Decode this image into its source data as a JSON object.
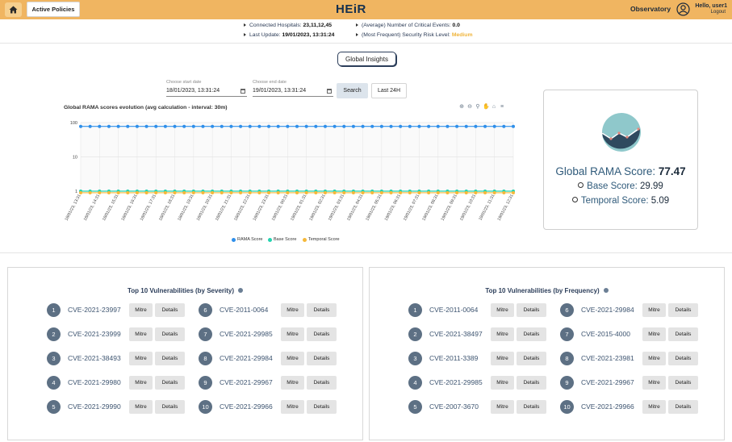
{
  "header": {
    "active_policies": "Active Policies",
    "logo": "HEiR",
    "observatory": "Observatory",
    "hello": "Hello, user1",
    "logout": "Logout",
    "bar_color": "#f0b561",
    "icons": [
      "home-icon",
      "user-icon"
    ]
  },
  "info": {
    "connected_label": "Connected Hospitals:",
    "connected_value": "23,11,12,45",
    "update_label": "Last Update:",
    "update_value": "19/01/2023, 13:31:24",
    "critical_label": "(Average) Number of Critical Events:",
    "critical_value": "0.0",
    "risk_label": "(Most Frequent) Security Risk Level:",
    "risk_value": "Medium",
    "risk_color": "#f0b43a"
  },
  "global_insights": "Global Insights",
  "date_filter": {
    "start_label": "Choose start date",
    "start_value": "18/01/2023, 13:31:24",
    "end_label": "Choose end date",
    "end_value": "19/01/2023, 13:31:24",
    "search": "Search",
    "last24": "Last 24H"
  },
  "chart_data": {
    "type": "line",
    "title": "Global RAMA scores evolution (avg calculation - interval: 30m)",
    "yscale": "log",
    "ylim": [
      1,
      100
    ],
    "y_ticks": [
      "100",
      "10",
      "1"
    ],
    "x": [
      "18/01/23, 13:31",
      "18/01/23, 14:31",
      "18/01/23, 15:31",
      "18/01/23, 16:31",
      "18/01/23, 17:31",
      "18/01/23, 18:31",
      "18/01/23, 19:31",
      "18/01/23, 20:31",
      "18/01/23, 21:31",
      "18/01/23, 22:31",
      "18/01/23, 23:31",
      "19/01/23, 00:31",
      "19/01/23, 01:31",
      "19/01/23, 02:31",
      "19/01/23, 03:31",
      "19/01/23, 04:31",
      "19/01/23, 05:31",
      "19/01/23, 06:31",
      "19/01/23, 07:31",
      "19/01/23, 08:31",
      "19/01/23, 09:31",
      "19/01/23, 10:31",
      "19/01/23, 11:31",
      "19/01/23, 12:31"
    ],
    "points_per_label": 2,
    "series": [
      {
        "name": "RAMA Score",
        "color": "#2f8fea",
        "value": 77.47
      },
      {
        "name": "Base Score",
        "color": "#24d3b0",
        "value": 1.0
      },
      {
        "name": "Temporal Score",
        "color": "#f5b83a",
        "value": 0.9
      }
    ],
    "legend_position": "bottom",
    "grid": true
  },
  "rama": {
    "global_label": "Global RAMA Score:",
    "global_value": "77.47",
    "base_label": "Base Score:",
    "base_value": "29.99",
    "temporal_label": "Temporal Score:",
    "temporal_value": "5.09",
    "icon_color_top": "#8fc8cb",
    "icon_color_bottom": "#2f4a5f"
  },
  "severity": {
    "title": "Top 10 Vulnerabilities (by Severity)",
    "items": [
      {
        "rank": "1",
        "cve": "CVE-2021-23997"
      },
      {
        "rank": "2",
        "cve": "CVE-2021-23999"
      },
      {
        "rank": "3",
        "cve": "CVE-2021-38493"
      },
      {
        "rank": "4",
        "cve": "CVE-2021-29980"
      },
      {
        "rank": "5",
        "cve": "CVE-2021-29990"
      },
      {
        "rank": "6",
        "cve": "CVE-2011-0064"
      },
      {
        "rank": "7",
        "cve": "CVE-2021-29985"
      },
      {
        "rank": "8",
        "cve": "CVE-2021-29984"
      },
      {
        "rank": "9",
        "cve": "CVE-2021-29967"
      },
      {
        "rank": "10",
        "cve": "CVE-2021-29966"
      }
    ]
  },
  "frequency": {
    "title": "Top 10 Vulnerabilities (by Frequency)",
    "items": [
      {
        "rank": "1",
        "cve": "CVE-2011-0064"
      },
      {
        "rank": "2",
        "cve": "CVE-2021-38497"
      },
      {
        "rank": "3",
        "cve": "CVE-2011-3389"
      },
      {
        "rank": "4",
        "cve": "CVE-2021-29985"
      },
      {
        "rank": "5",
        "cve": "CVE-2007-3670"
      },
      {
        "rank": "6",
        "cve": "CVE-2021-29984"
      },
      {
        "rank": "7",
        "cve": "CVE-2015-4000"
      },
      {
        "rank": "8",
        "cve": "CVE-2021-23981"
      },
      {
        "rank": "9",
        "cve": "CVE-2021-29967"
      },
      {
        "rank": "10",
        "cve": "CVE-2021-29966"
      }
    ]
  },
  "buttons": {
    "mitre": "Mitre",
    "details": "Details"
  }
}
